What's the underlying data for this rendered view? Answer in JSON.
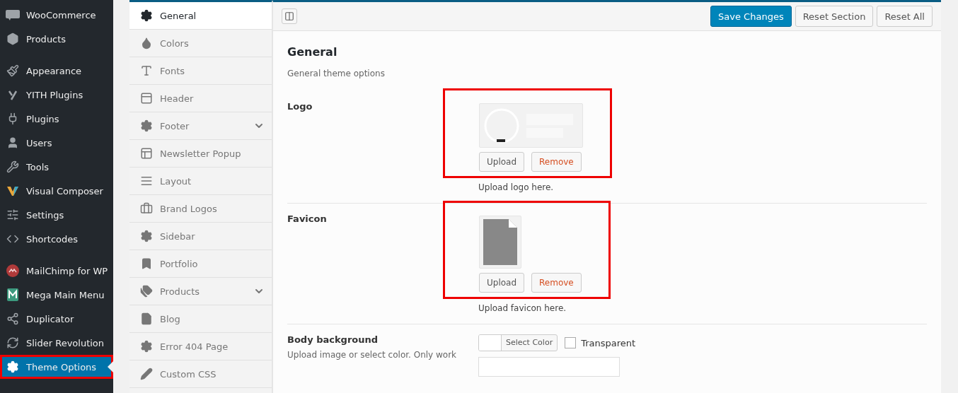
{
  "admin_menu": {
    "groups": [
      [
        {
          "label": "WooCommerce",
          "selected": false,
          "highlighted": false
        },
        {
          "label": "Products",
          "selected": false,
          "highlighted": false
        }
      ],
      [
        {
          "label": "Appearance",
          "selected": false,
          "highlighted": false
        },
        {
          "label": "YITH Plugins",
          "selected": false,
          "highlighted": false
        },
        {
          "label": "Plugins",
          "selected": false,
          "highlighted": false
        },
        {
          "label": "Users",
          "selected": false,
          "highlighted": false
        },
        {
          "label": "Tools",
          "selected": false,
          "highlighted": false
        },
        {
          "label": "Visual Composer",
          "selected": false,
          "highlighted": false
        },
        {
          "label": "Settings",
          "selected": false,
          "highlighted": false
        },
        {
          "label": "Shortcodes",
          "selected": false,
          "highlighted": false
        }
      ],
      [
        {
          "label": "MailChimp for WP",
          "selected": false,
          "highlighted": false
        },
        {
          "label": "Mega Main Menu",
          "selected": false,
          "highlighted": false
        },
        {
          "label": "Duplicator",
          "selected": false,
          "highlighted": false
        },
        {
          "label": "Slider Revolution",
          "selected": false,
          "highlighted": false
        },
        {
          "label": "Theme Options",
          "selected": true,
          "highlighted": true
        }
      ]
    ]
  },
  "sections": [
    {
      "label": "General",
      "selected": true,
      "expandable": false
    },
    {
      "label": "Colors",
      "selected": false,
      "expandable": false
    },
    {
      "label": "Fonts",
      "selected": false,
      "expandable": false
    },
    {
      "label": "Header",
      "selected": false,
      "expandable": false
    },
    {
      "label": "Footer",
      "selected": false,
      "expandable": true
    },
    {
      "label": "Newsletter Popup",
      "selected": false,
      "expandable": false
    },
    {
      "label": "Layout",
      "selected": false,
      "expandable": false
    },
    {
      "label": "Brand Logos",
      "selected": false,
      "expandable": false
    },
    {
      "label": "Sidebar",
      "selected": false,
      "expandable": false
    },
    {
      "label": "Portfolio",
      "selected": false,
      "expandable": false
    },
    {
      "label": "Products",
      "selected": false,
      "expandable": true
    },
    {
      "label": "Blog",
      "selected": false,
      "expandable": false
    },
    {
      "label": "Error 404 Page",
      "selected": false,
      "expandable": false
    },
    {
      "label": "Custom CSS",
      "selected": false,
      "expandable": false
    }
  ],
  "toolbar": {
    "buttons": [
      {
        "label": "Save Changes",
        "kind": "primary"
      },
      {
        "label": "Reset Section",
        "kind": "secondary"
      },
      {
        "label": "Reset All",
        "kind": "secondary"
      }
    ]
  },
  "panel": {
    "title": "General",
    "description": "General theme options",
    "options": [
      {
        "kind": "logo",
        "label": "Logo",
        "highlighted": true,
        "upload": "Upload",
        "remove": "Remove",
        "hint": "Upload logo here."
      },
      {
        "kind": "favicon",
        "label": "Favicon",
        "highlighted": true,
        "upload": "Upload",
        "remove": "Remove",
        "hint": "Upload favicon here."
      },
      {
        "kind": "color",
        "label": "Body background",
        "description": "Upload image or select color. Only work",
        "button": "Select Color",
        "checkbox_label": "Transparent",
        "transparent": false
      }
    ]
  }
}
